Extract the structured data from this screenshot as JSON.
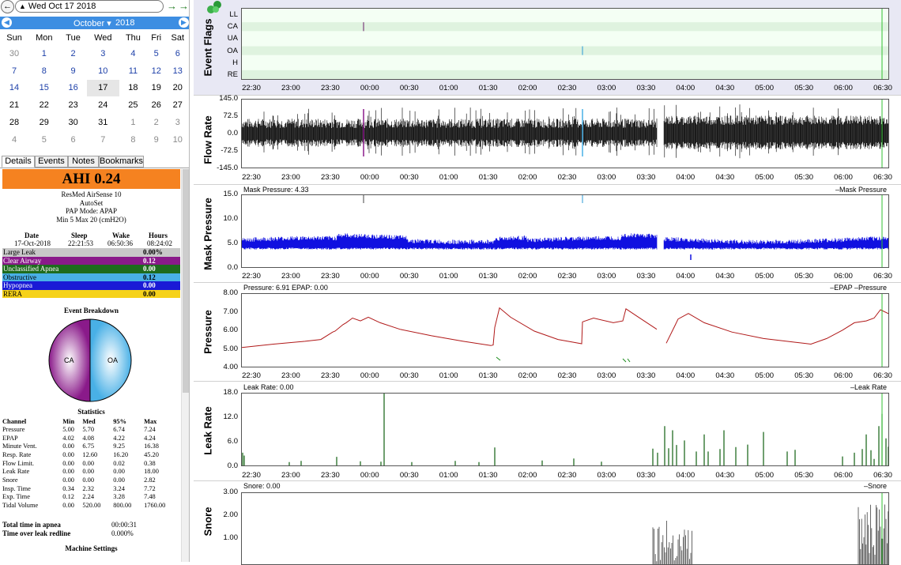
{
  "datebar": {
    "date_text": "Wed Oct 17 2018",
    "back_icon": "back-arrow-icon",
    "forward_label": "→",
    "last_label": "→|"
  },
  "calendar": {
    "month": "October",
    "year": "2018",
    "days": [
      "Sun",
      "Mon",
      "Tue",
      "Wed",
      "Thu",
      "Fri",
      "Sat"
    ],
    "weeks": [
      [
        {
          "d": "30",
          "c": "grey"
        },
        {
          "d": "1",
          "c": "blue"
        },
        {
          "d": "2",
          "c": "blue"
        },
        {
          "d": "3",
          "c": "blue"
        },
        {
          "d": "4",
          "c": "blue"
        },
        {
          "d": "5",
          "c": "blue"
        },
        {
          "d": "6",
          "c": "blue"
        }
      ],
      [
        {
          "d": "7",
          "c": "blue"
        },
        {
          "d": "8",
          "c": "blue"
        },
        {
          "d": "9",
          "c": "blue"
        },
        {
          "d": "10",
          "c": "blue"
        },
        {
          "d": "11",
          "c": "blue"
        },
        {
          "d": "12",
          "c": "blue"
        },
        {
          "d": "13",
          "c": "blue"
        }
      ],
      [
        {
          "d": "14",
          "c": "blue"
        },
        {
          "d": "15",
          "c": "blue"
        },
        {
          "d": "16",
          "c": "blue"
        },
        {
          "d": "17",
          "c": "sel"
        },
        {
          "d": "18",
          "c": ""
        },
        {
          "d": "19",
          "c": ""
        },
        {
          "d": "20",
          "c": ""
        }
      ],
      [
        {
          "d": "21",
          "c": ""
        },
        {
          "d": "22",
          "c": ""
        },
        {
          "d": "23",
          "c": ""
        },
        {
          "d": "24",
          "c": ""
        },
        {
          "d": "25",
          "c": ""
        },
        {
          "d": "26",
          "c": ""
        },
        {
          "d": "27",
          "c": ""
        }
      ],
      [
        {
          "d": "28",
          "c": ""
        },
        {
          "d": "29",
          "c": ""
        },
        {
          "d": "30",
          "c": ""
        },
        {
          "d": "31",
          "c": ""
        },
        {
          "d": "1",
          "c": "grey"
        },
        {
          "d": "2",
          "c": "grey"
        },
        {
          "d": "3",
          "c": "grey"
        }
      ],
      [
        {
          "d": "4",
          "c": "grey"
        },
        {
          "d": "5",
          "c": "grey"
        },
        {
          "d": "6",
          "c": "grey"
        },
        {
          "d": "7",
          "c": "grey"
        },
        {
          "d": "8",
          "c": "grey"
        },
        {
          "d": "9",
          "c": "grey"
        },
        {
          "d": "10",
          "c": "grey"
        }
      ]
    ]
  },
  "tabs": [
    "Details",
    "Events",
    "Notes",
    "Bookmarks"
  ],
  "details": {
    "ahi": "AHI 0.24",
    "device": [
      "ResMed AirSense 10",
      "AutoSet",
      "PAP Mode: APAP",
      "Min 5 Max 20 (cmH2O)"
    ],
    "summary_headers": [
      "Date",
      "Sleep",
      "Wake",
      "Hours"
    ],
    "summary_values": [
      "17-Oct-2018",
      "22:21:53",
      "06:50:36",
      "08:24:02"
    ],
    "events": [
      {
        "label": "Large Leak",
        "value": "0.00%",
        "color": "#c8c8c8",
        "text": "#000"
      },
      {
        "label": "Clear Airway",
        "value": "0.12",
        "color": "#8a1a8a",
        "text": "#fff"
      },
      {
        "label": "Unclassified Apnea",
        "value": "0.00",
        "color": "#1e6b1e",
        "text": "#fff"
      },
      {
        "label": "Obstructive",
        "value": "0.12",
        "color": "#49b0e6",
        "text": "#000"
      },
      {
        "label": "Hypopnea",
        "value": "0.00",
        "color": "#1a1ad6",
        "text": "#fff"
      },
      {
        "label": "RERA",
        "value": "0.00",
        "color": "#f6d21a",
        "text": "#000"
      }
    ],
    "breakdown_title": "Event Breakdown",
    "pie": [
      {
        "label": "CA",
        "value": 0.5,
        "color": "#8a1a8a"
      },
      {
        "label": "OA",
        "value": 0.5,
        "color": "#49b0e6"
      }
    ],
    "stats_title": "Statistics",
    "stats_headers": [
      "Channel",
      "Min",
      "Med",
      "95%",
      "Max"
    ],
    "stats_rows": [
      [
        "Pressure",
        "5.00",
        "5.70",
        "6.74",
        "7.24"
      ],
      [
        "EPAP",
        "4.02",
        "4.08",
        "4.22",
        "4.24"
      ],
      [
        "Minute Vent.",
        "0.00",
        "6.75",
        "9.25",
        "16.38"
      ],
      [
        "Resp. Rate",
        "0.00",
        "12.60",
        "16.20",
        "45.20"
      ],
      [
        "Flow Limit.",
        "0.00",
        "0.00",
        "0.02",
        "0.38"
      ],
      [
        "Leak Rate",
        "0.00",
        "0.00",
        "0.00",
        "18.00"
      ],
      [
        "Snore",
        "0.00",
        "0.00",
        "0.00",
        "2.82"
      ],
      [
        "Insp. Time",
        "0.34",
        "2.32",
        "3.24",
        "7.72"
      ],
      [
        "Exp. Time",
        "0.12",
        "2.24",
        "3.28",
        "7.48"
      ],
      [
        "Tidal Volume",
        "0.00",
        "520.00",
        "800.00",
        "1760.00"
      ]
    ],
    "totals": [
      {
        "label": "Total time in apnea",
        "value": "00:00:31"
      },
      {
        "label": "Time over leak redline",
        "value": "0.000%"
      }
    ],
    "machine_settings": "Machine Settings"
  },
  "time_ticks": [
    "22:30",
    "23:00",
    "23:30",
    "00:00",
    "00:30",
    "01:00",
    "01:30",
    "02:00",
    "02:30",
    "03:00",
    "03:30",
    "04:00",
    "04:30",
    "05:00",
    "05:30",
    "06:00",
    "06:30"
  ],
  "graphs": {
    "event_flags": {
      "label": "Event Flags",
      "rows": [
        "LL",
        "CA",
        "UA",
        "OA",
        "H",
        "RE"
      ]
    },
    "flow_rate": {
      "label": "Flow Rate",
      "yticks": [
        "145.0",
        "72.5",
        "0.0",
        "-72.5",
        "-145.0"
      ]
    },
    "mask_pressure": {
      "label": "Mask Pressure",
      "title": "Mask Pressure: 4.33",
      "legend": "–Mask Pressure",
      "yticks": [
        "15.0",
        "10.0",
        "5.0",
        "0.0"
      ]
    },
    "pressure": {
      "label": "Pressure",
      "title": "Pressure: 6.91 EPAP: 0.00",
      "legend": "–EPAP –Pressure",
      "yticks": [
        "8.00",
        "7.00",
        "6.00",
        "5.00",
        "4.00"
      ]
    },
    "leak_rate": {
      "label": "Leak Rate",
      "title": "Leak Rate: 0.00",
      "legend": "–Leak Rate",
      "yticks": [
        "18.0",
        "12.0",
        "6.0",
        "0.0"
      ]
    },
    "snore": {
      "label": "Snore",
      "title": "Snore: 0.00",
      "legend": "–Snore",
      "yticks": [
        "3.00",
        "2.00",
        "1.00"
      ]
    }
  },
  "colors": {
    "accent": "#3d8ee2",
    "ahi": "#f58220",
    "flow": "#000000",
    "mask_pressure": "#1010e0",
    "pressure": "#b01818",
    "leak": "#106010",
    "snore": "#404040",
    "flags_bg": "#e8f8e8",
    "cursor": "#30c030"
  }
}
